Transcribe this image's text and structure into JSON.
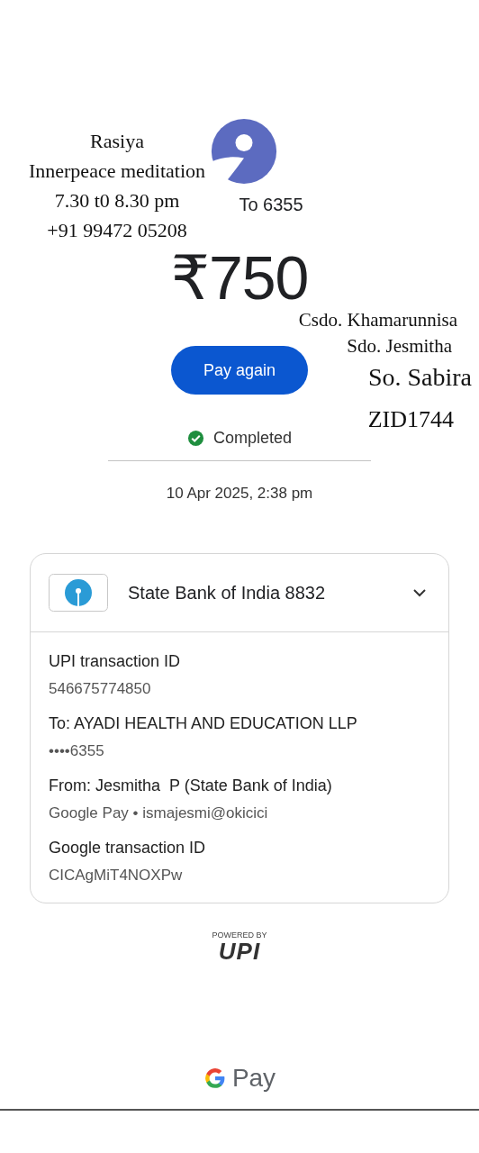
{
  "recipient": {
    "label": "To 6355"
  },
  "amount": "₹750",
  "pay_again_button": "Pay again",
  "status": {
    "label": "Completed",
    "completed": true
  },
  "date": "10 Apr 2025, 2:38 pm",
  "account": {
    "name": "State Bank of India 8832",
    "expanded": false
  },
  "details": [
    {
      "label": "UPI transaction ID",
      "value": "546675774850"
    },
    {
      "label": "To: AYADI HEALTH AND EDUCATION LLP",
      "value": "••••6355"
    },
    {
      "label": "From: Jesmitha  P (State Bank of India)",
      "value": "Google Pay • ismajesmi@okicici"
    },
    {
      "label": "Google transaction ID",
      "value": "CICAgMiT4NOXPw"
    }
  ],
  "footer": {
    "powered_by": "POWERED BY",
    "upi": "UPI",
    "brand": "Pay"
  },
  "notes_left": [
    "Rasiya",
    "Innerpeace meditation",
    "7.30 t0 8.30 pm",
    "+91 99472 05208"
  ],
  "notes_right": [
    "Csdo. Khamarunnisa",
    "Sdo. Jesmitha",
    "So. Sabira",
    "ZID1744"
  ]
}
